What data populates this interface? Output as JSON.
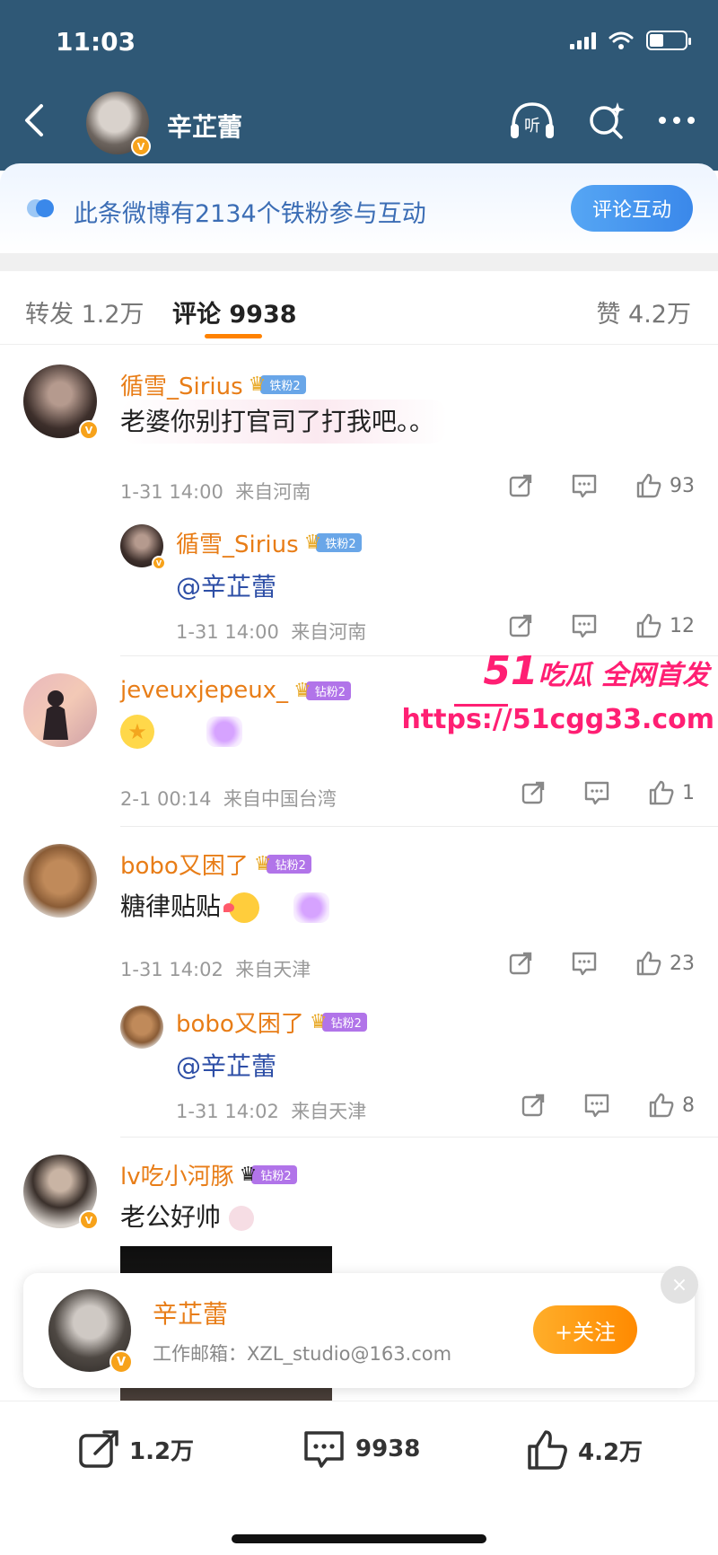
{
  "status": {
    "time": "11:03"
  },
  "nav": {
    "name": "辛芷蕾",
    "listen_label": "听"
  },
  "fans": {
    "text": "此条微博有2134个铁粉参与互动",
    "button": "评论互动"
  },
  "tabs": {
    "repost": "转发 1.2万",
    "comment": "评论 9938",
    "like": "赞 4.2万"
  },
  "comments": [
    {
      "name": "循雪_Sirius",
      "badge": "铁粉2",
      "text": "老婆你别打官司了打我吧。。",
      "time": "1-31 14:00",
      "location": "来自河南",
      "likes": "93",
      "reply": {
        "name": "循雪_Sirius",
        "badge": "铁粉2",
        "text": "@辛芷蕾",
        "time": "1-31 14:00",
        "location": "来自河南",
        "likes": "12"
      }
    },
    {
      "name": "jeveuxjepeux_",
      "badge": "钻粉2",
      "text": "",
      "time": "2-1 00:14",
      "location": "来自中国台湾",
      "likes": "1"
    },
    {
      "name": "bobo又困了",
      "badge": "钻粉2",
      "text": "糖律贴贴",
      "time": "1-31 14:02",
      "location": "来自天津",
      "likes": "23",
      "reply": {
        "name": "bobo又困了",
        "badge": "钻粉2",
        "text": "@辛芷蕾",
        "time": "1-31 14:02",
        "location": "来自天津",
        "likes": "8"
      }
    },
    {
      "name": "lv吃小河豚",
      "badge": "钻粉2",
      "text": "老公好帅"
    }
  ],
  "watermark": {
    "brand_num": "51",
    "brand_text": "吃瓜 全网首发",
    "url": "https://51cgg33.com"
  },
  "profile_card": {
    "name": "辛芷蕾",
    "email": "工作邮箱：XZL_studio@163.com",
    "follow": "+关注",
    "close": "×"
  },
  "bottom_bar": {
    "repost": "1.2万",
    "comment": "9938",
    "like": "4.2万"
  },
  "colors": {
    "header_bg": "#2f5876",
    "accent_orange": "#ff8200",
    "name_orange": "#e87d17",
    "link_blue": "#2d4ea6",
    "watermark_pink": "#ff1f73"
  },
  "icons": [
    "back-icon",
    "headphone-icon",
    "search-sparkle-icon",
    "more-icon",
    "repost-icon",
    "comment-icon",
    "like-icon",
    "star-emoji",
    "gem-emoji",
    "kiss-emoji"
  ]
}
